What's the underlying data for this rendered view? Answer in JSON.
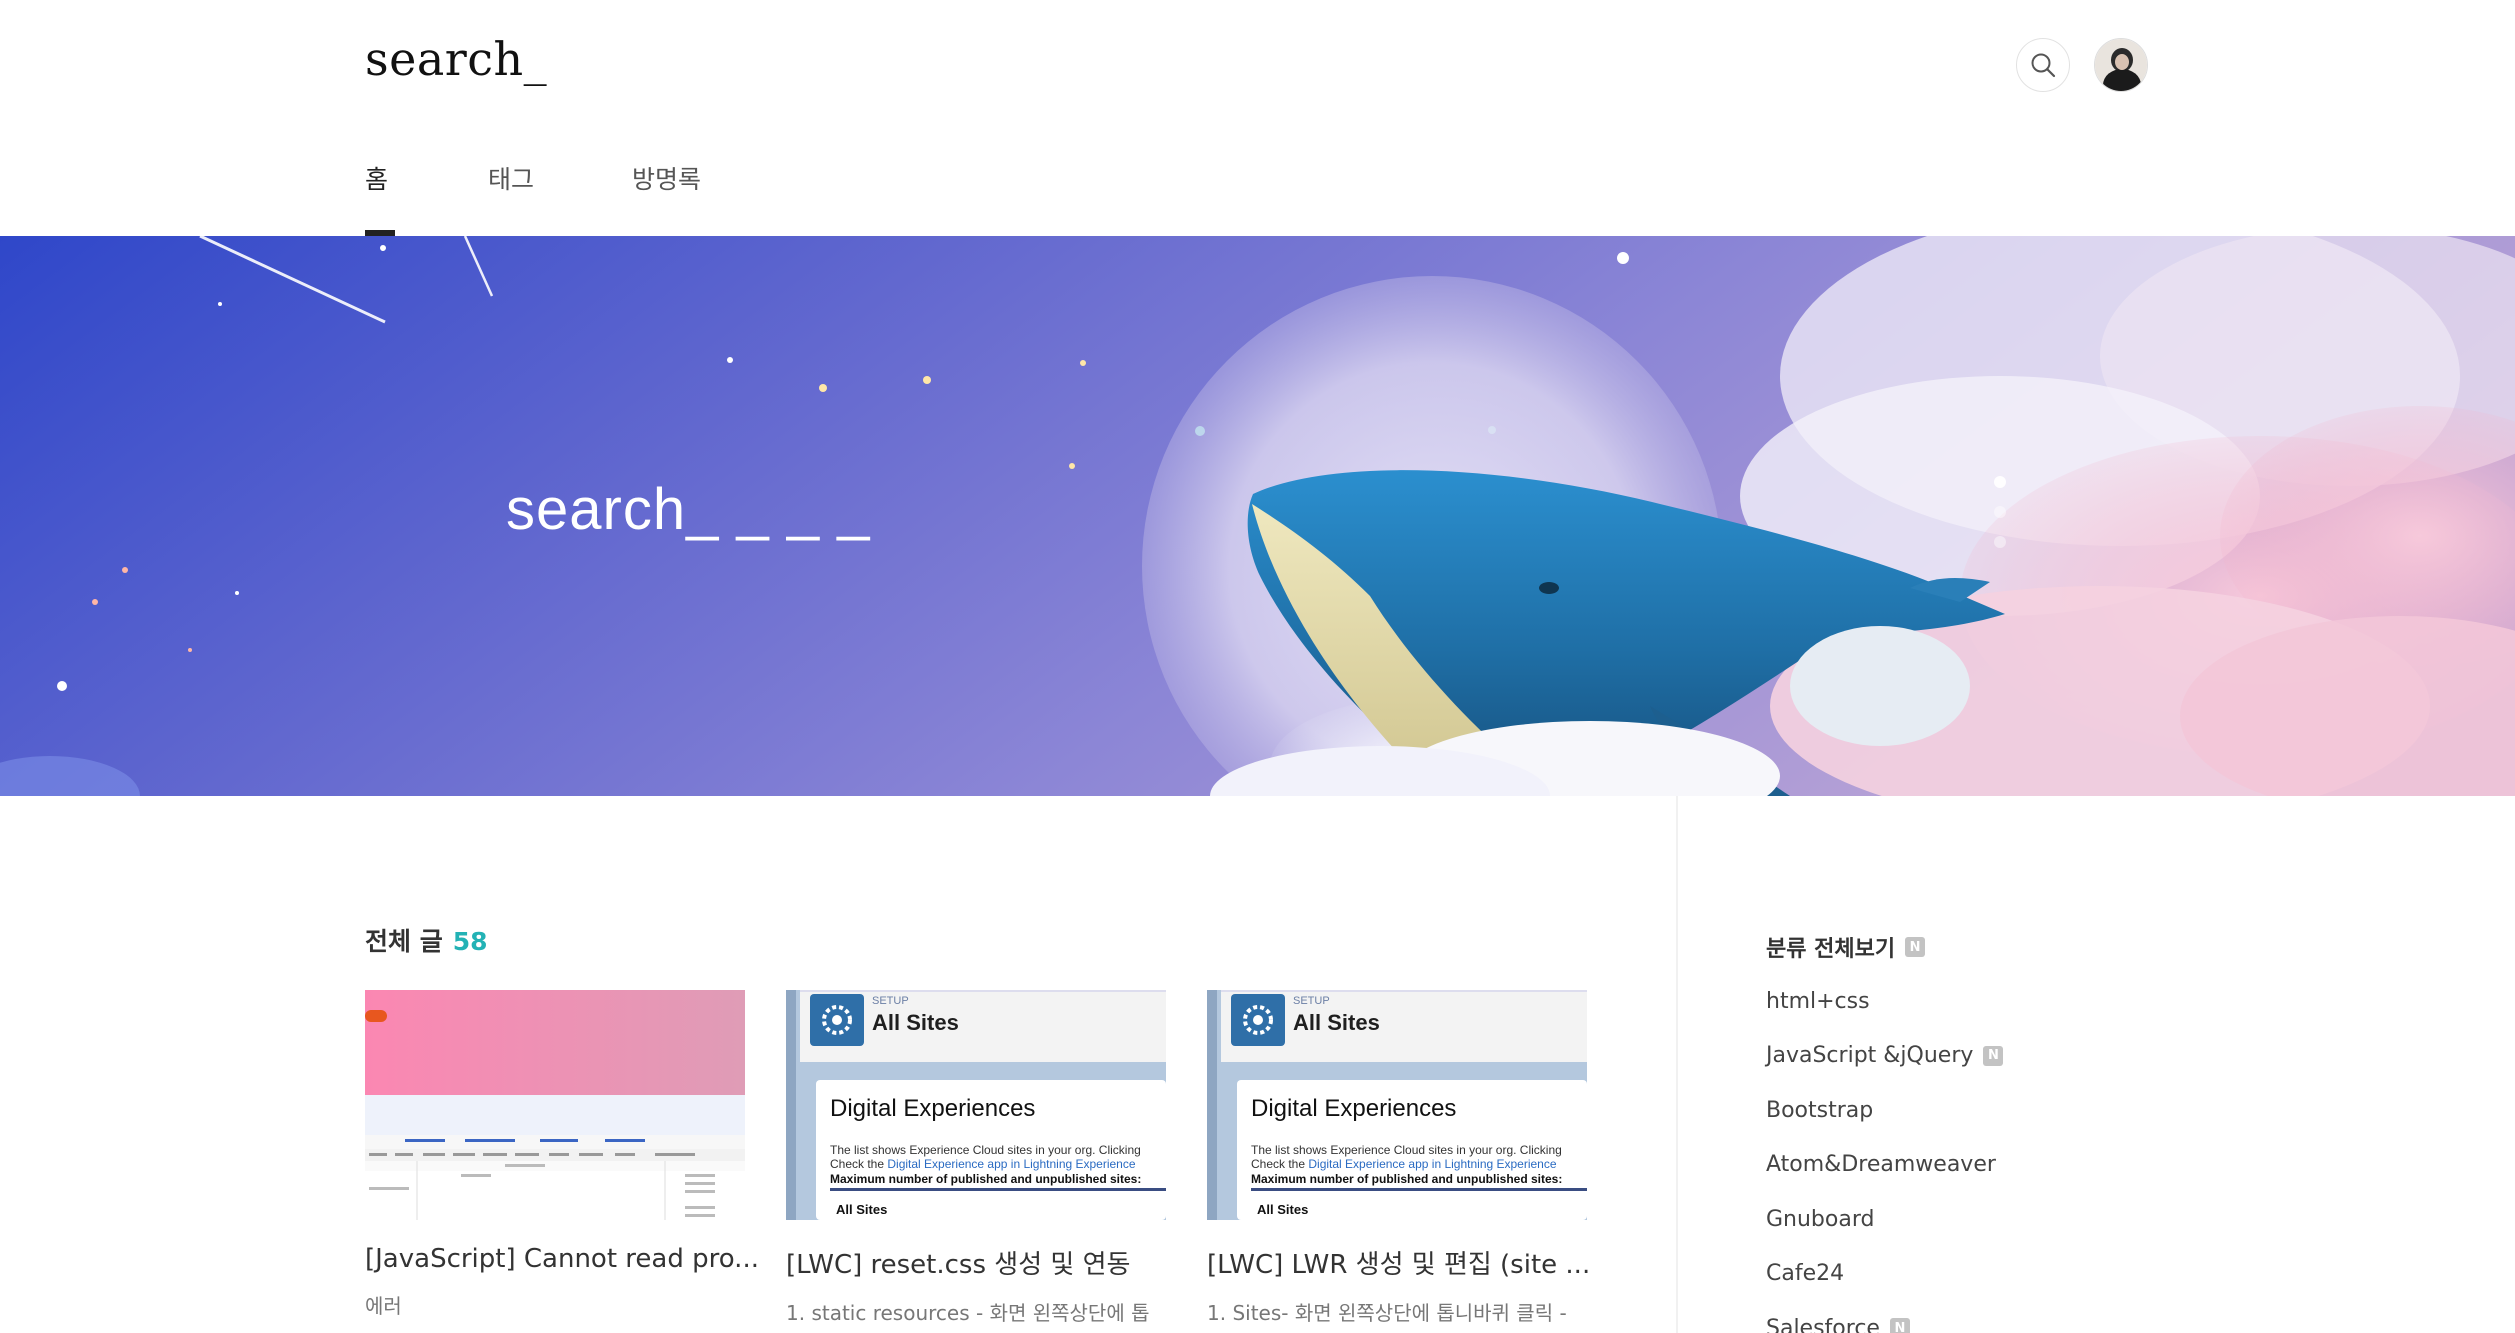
{
  "header": {
    "logo": "search_",
    "search_icon": "search-icon",
    "avatar_icon": "profile-avatar"
  },
  "nav": {
    "tabs": [
      {
        "label": "홈",
        "active": true
      },
      {
        "label": "태그",
        "active": false
      },
      {
        "label": "방명록",
        "active": false
      }
    ]
  },
  "hero": {
    "title": "search_ _ _ _",
    "slides": 3,
    "active_slide": 1
  },
  "posts": {
    "heading": "전체 글",
    "count": "58",
    "items": [
      {
        "title": "[JavaScript] Cannot read pro...",
        "summary": "에러",
        "thumb_kind": "devtools"
      },
      {
        "title": "[LWC] reset.css 생성 및 연동",
        "summary": "1. static resources - 화면 왼쪽상단에 톱",
        "thumb_kind": "setup",
        "thumb_setup": "SETUP",
        "thumb_header": "All Sites",
        "thumb_title": "Digital Experiences",
        "thumb_line1": "The list shows Experience Cloud sites in your org. Clicking",
        "thumb_line2a": "Check the ",
        "thumb_line2b": "Digital Experience app in Lightning Experience",
        "thumb_line3": "Maximum number of published and unpublished sites:",
        "thumb_line4": "All Sites"
      },
      {
        "title": "[LWC] LWR 생성 및 편집 (site ...",
        "summary": "1. Sites- 화면 왼쪽상단에 톱니바퀴 클릭 -",
        "thumb_kind": "setup",
        "thumb_setup": "SETUP",
        "thumb_header": "All Sites",
        "thumb_title": "Digital Experiences",
        "thumb_line1": "The list shows Experience Cloud sites in your org. Clicking",
        "thumb_line2a": "Check the ",
        "thumb_line2b": "Digital Experience app in Lightning Experience",
        "thumb_line3": "Maximum number of published and unpublished sites:",
        "thumb_line4": "All Sites"
      }
    ]
  },
  "sidebar": {
    "heading": "분류 전체보기",
    "heading_new": true,
    "categories": [
      {
        "label": "html+css",
        "new": false
      },
      {
        "label": "JavaScript &jQuery",
        "new": true
      },
      {
        "label": "Bootstrap",
        "new": false
      },
      {
        "label": "Atom&Dreamweaver",
        "new": false
      },
      {
        "label": "Gnuboard",
        "new": false
      },
      {
        "label": "Cafe24",
        "new": false
      },
      {
        "label": "Salesforce",
        "new": true
      }
    ],
    "new_badge": "N"
  },
  "colors": {
    "accent": "#23b2b5",
    "hero_sky_top": "#3a4fd0",
    "hero_sky_mid": "#7a78d6",
    "hero_cloud_pink": "#f3c2d6",
    "whale_blue": "#2f86c2"
  }
}
